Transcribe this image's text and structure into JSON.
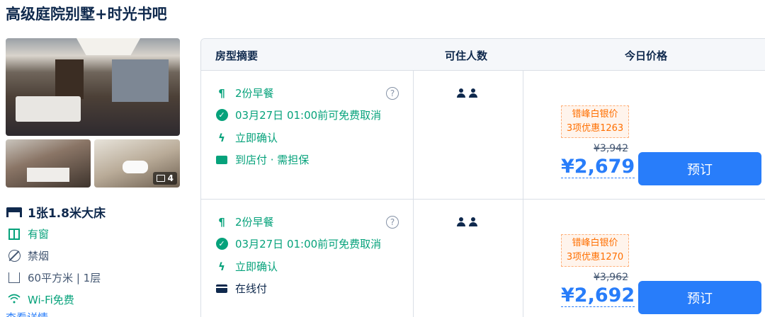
{
  "room": {
    "title": "高级庭院别墅+时光书吧",
    "photo_count": "4",
    "facts": {
      "bed": "1张1.8米大床",
      "window": "有窗",
      "smoking": "禁烟",
      "area": "60平方米 | 1层",
      "wifi": "Wi-Fi免费"
    },
    "more_link": "查看详情"
  },
  "table": {
    "headers": {
      "summary": "房型摘要",
      "occupancy": "可住人数",
      "price": "今日价格"
    },
    "rows": [
      {
        "breakfast": "2份早餐",
        "cancel": "03月27日 01:00前可免费取消",
        "confirm": "立即确认",
        "payment": "到店付 · 需担保",
        "promo_title": "错峰白银价",
        "promo_detail": "3项优惠1263",
        "original_price": "¥3,942",
        "price": "¥2,679",
        "book_label": "预订"
      },
      {
        "breakfast": "2份早餐",
        "cancel": "03月27日 01:00前可免费取消",
        "confirm": "立即确认",
        "payment": "在线付",
        "promo_title": "错峰白银价",
        "promo_detail": "3项优惠1270",
        "original_price": "¥3,962",
        "price": "¥2,692",
        "book_label": "预订"
      }
    ]
  },
  "help_label": "?",
  "icons": [
    "fork-knife-icon",
    "check-circle-icon",
    "lightning-icon",
    "pay-at-hotel-icon",
    "card-icon",
    "person-icon",
    "bed-icon",
    "window-icon",
    "no-smoking-icon",
    "area-icon",
    "wifi-icon",
    "image-icon",
    "help-icon"
  ],
  "colors": {
    "accent": "#287dfa",
    "green": "#06a27b",
    "promo": "#ff6f00",
    "text": "#0f294d"
  }
}
